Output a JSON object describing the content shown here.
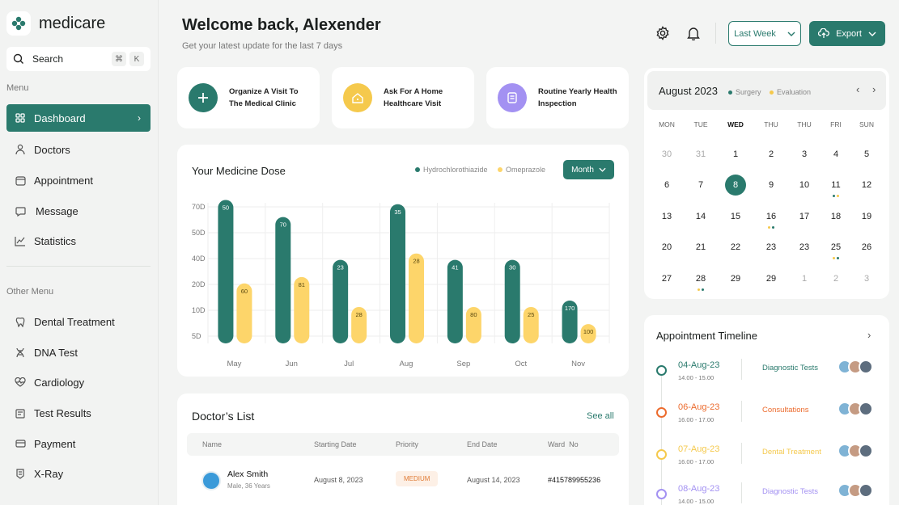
{
  "app": {
    "name": "medicare"
  },
  "search": {
    "label": "Search",
    "kbd": [
      "⌘",
      "K"
    ]
  },
  "menu": {
    "title": "Menu",
    "items": [
      {
        "label": "Dashboard",
        "icon": "grid-icon",
        "active": true
      },
      {
        "label": "Doctors",
        "icon": "doctor-icon"
      },
      {
        "label": "Appointment",
        "icon": "calendar-icon"
      },
      {
        "label": "Message",
        "icon": "message-icon"
      },
      {
        "label": "Statistics",
        "icon": "chart-icon"
      }
    ]
  },
  "other_menu": {
    "title": "Other Menu",
    "items": [
      {
        "label": "Dental Treatment",
        "icon": "tooth-icon"
      },
      {
        "label": "DNA Test",
        "icon": "dna-icon"
      },
      {
        "label": "Cardiology",
        "icon": "heart-icon"
      },
      {
        "label": "Test Results",
        "icon": "clipboard-icon"
      },
      {
        "label": "Payment",
        "icon": "wallet-icon"
      },
      {
        "label": "X-Ray",
        "icon": "xray-icon"
      }
    ]
  },
  "header": {
    "title": "Welcome back, Alexender",
    "subtitle": "Get your latest update for the last 7 days",
    "range_label": "Last Week",
    "export_label": "Export"
  },
  "actions": [
    {
      "text": "Organize A Visit To\nThe Medical Clinic",
      "color": "#2a7a6d",
      "icon": "plus-icon"
    },
    {
      "text": "Ask For A Home\nHealthcare Visit",
      "color": "#f5c94c",
      "icon": "home-icon"
    },
    {
      "text": "Routine Yearly Health\nInspection",
      "color": "#a391f2",
      "icon": "document-icon"
    }
  ],
  "chart_data": {
    "type": "bar",
    "title": "Your Medicine Dose",
    "period_label": "Month",
    "categories": [
      "May",
      "Jun",
      "Jul",
      "Aug",
      "Sep",
      "Oct",
      "Nov"
    ],
    "y_tick_labels": [
      "70D",
      "50D",
      "40D",
      "20D",
      "10D",
      "5D"
    ],
    "series": [
      {
        "name": "Hydrochlorothiazide",
        "color": "#2a7a6d",
        "heights": [
          6.7,
          5.9,
          3.9,
          6.5,
          3.9,
          3.9,
          2.0
        ],
        "labels": [
          "50",
          "70",
          "23",
          "35",
          "41",
          "30",
          "170"
        ]
      },
      {
        "name": "Omeprazole",
        "color": "#fdd56a",
        "heights": [
          2.8,
          3.1,
          1.7,
          4.2,
          1.7,
          1.7,
          0.9
        ],
        "labels": [
          "60",
          "81",
          "28",
          "28",
          "80",
          "25",
          "100"
        ]
      }
    ]
  },
  "doctors": {
    "title": "Doctor’s List",
    "see_all": "See all",
    "columns": [
      "Name",
      "Starting Date",
      "Priority",
      "End Date",
      "Ward  No"
    ],
    "rows": [
      {
        "name": "Alex Smith",
        "meta": "Male, 36 Years",
        "start": "August 8, 2023",
        "priority": "MEDIUM",
        "end": "August 14, 2023",
        "ward": "#415789955236"
      }
    ]
  },
  "calendar": {
    "month": "August 2023",
    "legend": [
      {
        "label": "Surgery",
        "color": "#2a7a6d"
      },
      {
        "label": "Evaluation",
        "color": "#f5c94c"
      }
    ],
    "weekdays": [
      "MON",
      "TUE",
      "WED",
      "THU",
      "THU",
      "FRI",
      "SUN"
    ],
    "weeks": [
      [
        "30",
        "31",
        "1",
        "2",
        "3",
        "4",
        "5"
      ],
      [
        "6",
        "7",
        "8",
        "9",
        "10",
        "11",
        "12"
      ],
      [
        "13",
        "14",
        "15",
        "16",
        "17",
        "18",
        "19"
      ],
      [
        "20",
        "21",
        "22",
        "23",
        "23",
        "25",
        "26"
      ],
      [
        "27",
        "28",
        "29",
        "29",
        "1",
        "2",
        "3"
      ]
    ]
  },
  "timeline": {
    "title": "Appointment Timeline",
    "items": [
      {
        "date": "04-Aug-23",
        "time": "14.00 - 15.00",
        "label": "Diagnostic Tests",
        "color": "#2a7a6d"
      },
      {
        "date": "06-Aug-23",
        "time": "16.00 - 17.00",
        "label": "Consultations",
        "color": "#ec6b2d"
      },
      {
        "date": "07-Aug-23",
        "time": "16.00 - 17.00",
        "label": "Dental Treatment",
        "color": "#f5c94c"
      },
      {
        "date": "08-Aug-23",
        "time": "14.00 - 15.00",
        "label": "Diagnostic Tests",
        "color": "#a391f2"
      }
    ]
  }
}
